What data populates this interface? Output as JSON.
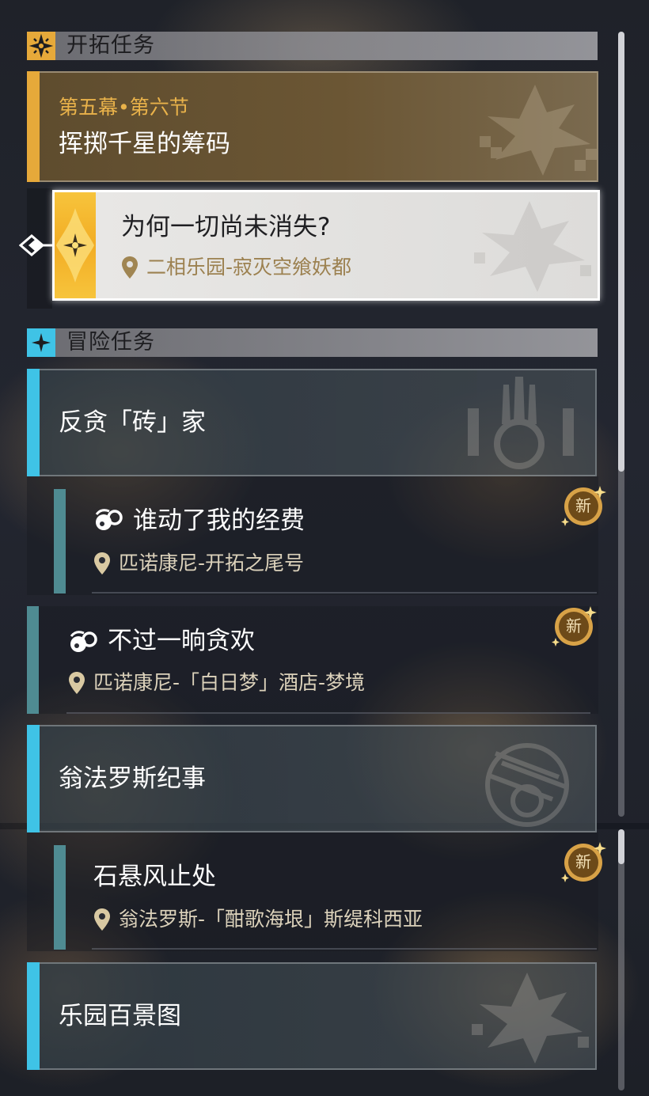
{
  "trailblaze": {
    "header": "开拓任务",
    "chapter": "第五幕•第六节",
    "mission_title": "挥掷千星的筹码",
    "quest": {
      "title": "为何一切尚未消失?",
      "location": "二相乐园-寂灭空飨妖都"
    }
  },
  "adventure": {
    "header": "冒险任务",
    "groups": [
      {
        "title": "反贪「砖」家",
        "quests": [
          {
            "title": "谁动了我的经费",
            "location": "匹诺康尼-开拓之尾号",
            "badge": "新"
          },
          {
            "title": "不过一晌贪欢",
            "location": "匹诺康尼-「白日梦」酒店-梦境",
            "badge": "新"
          }
        ]
      },
      {
        "title": "翁法罗斯纪事",
        "quests": [
          {
            "title": "石悬风止处",
            "location": "翁法罗斯-「酣歌海垠」斯缇科西亚",
            "badge": "新"
          }
        ]
      },
      {
        "title": "乐园百景图",
        "quests": []
      }
    ]
  },
  "colors": {
    "gold": "#e6a93a",
    "cyan": "#3fc3e6",
    "teal_stripe": "#4f8b92",
    "badge": "#d8a247"
  }
}
